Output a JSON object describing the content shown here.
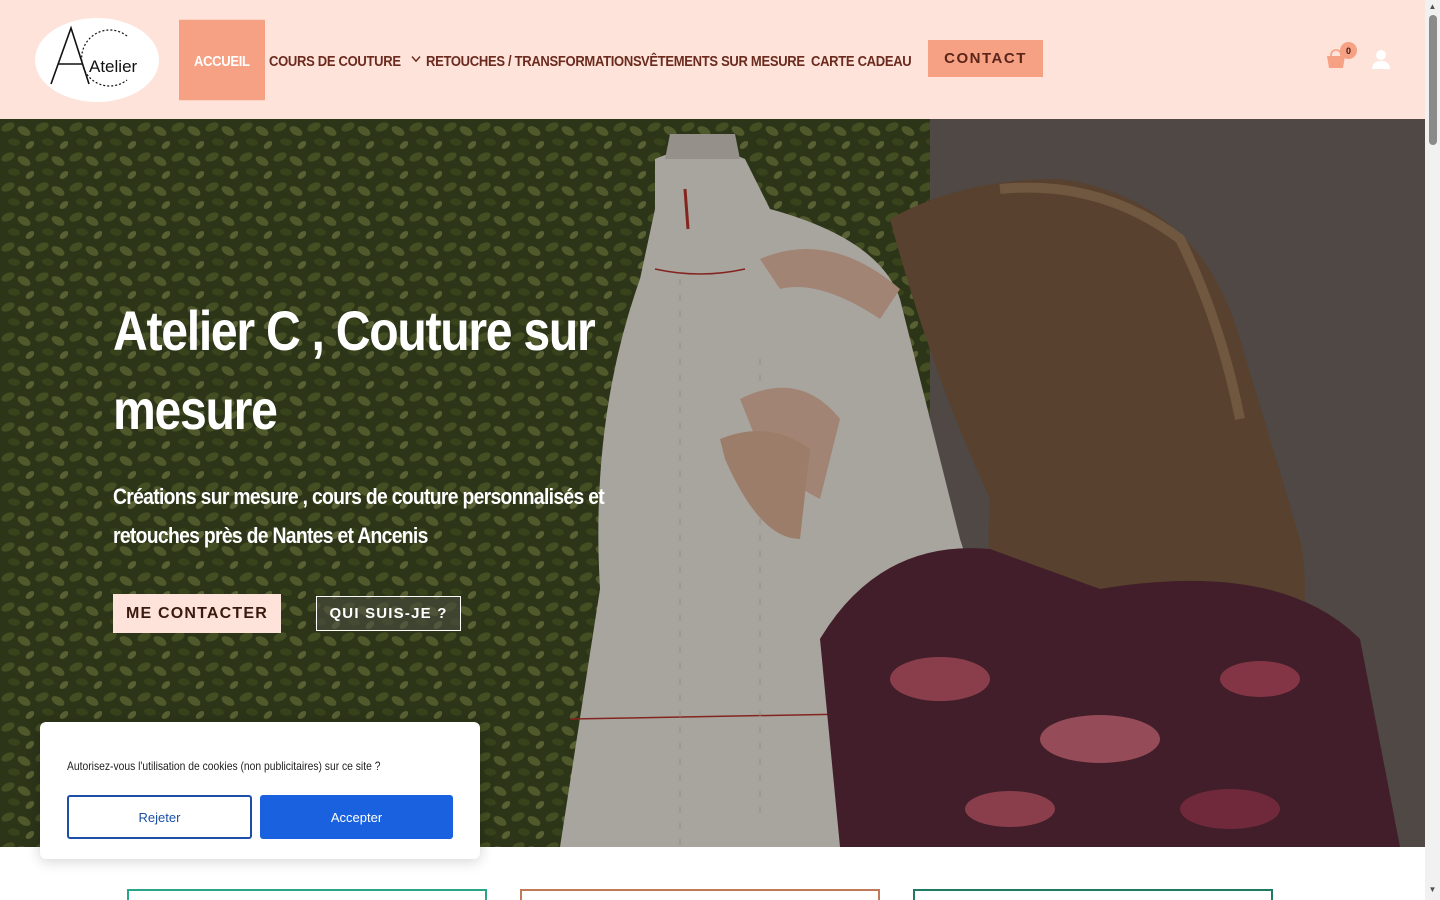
{
  "header": {
    "logo_text": "Atelier",
    "nav": [
      {
        "label": "Accueil",
        "active": true
      },
      {
        "label": "Cours de couture",
        "has_dropdown": true
      },
      {
        "label": "Retouches / transformations"
      },
      {
        "label": "Vêtements sur mesure"
      },
      {
        "label": "Carte cadeau"
      }
    ],
    "contact_label": "CONTACT",
    "cart_count": "0",
    "icons": [
      "cart-icon",
      "user-icon",
      "chevron-down-icon"
    ]
  },
  "hero": {
    "title": "Atelier C , Couture sur mesure",
    "subtitle": "Créations sur mesure , cours de couture personnalisés et retouches près de Nantes et Ancenis",
    "primary_button": "ME CONTACTER",
    "secondary_button": "QUI SUIS-JE ?"
  },
  "cookie": {
    "text": "Autorisez-vous l'utilisation de cookies (non publicitaires) sur ce site ?",
    "reject_label": "Rejeter",
    "accept_label": "Accepter"
  },
  "colors": {
    "header_bg": "#fde3da",
    "accent": "#f6a184",
    "nav_text": "#6b2a1d",
    "accept_blue": "#1a61e0",
    "reject_border": "#1d4fa6",
    "card_teal": "#2aa58a",
    "card_brown": "#c07a5a",
    "card_green": "#1e7a62"
  }
}
